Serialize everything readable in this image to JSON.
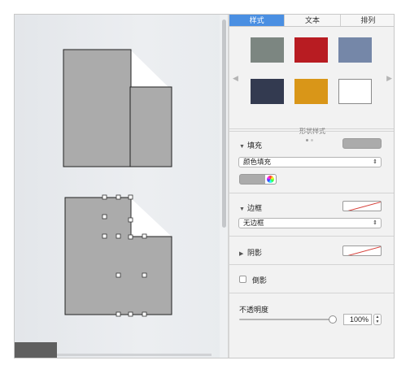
{
  "inspector": {
    "tabs": [
      {
        "label": "样式",
        "active": true
      },
      {
        "label": "文本",
        "active": false
      },
      {
        "label": "排列",
        "active": false
      }
    ],
    "styles": {
      "label": "形状样式",
      "swatches": [
        "#7c8681",
        "#b81c22",
        "#7587a8",
        "#333a50",
        "#d99618",
        "#ffffff"
      ],
      "prev_arrow": "◀",
      "next_arrow": "▶"
    },
    "fill": {
      "title": "填充",
      "select_value": "颜色填充",
      "color": "#ababab"
    },
    "border": {
      "title": "边框",
      "select_value": "无边框"
    },
    "shadow": {
      "title": "阴影"
    },
    "reflection": {
      "label": "倒影",
      "checked": false
    },
    "opacity": {
      "label": "不透明度",
      "value": "100%",
      "level": 1.0
    }
  },
  "icons": {
    "disclosure_open": "▼",
    "disclosure_closed": "▶",
    "select_chevron": "⇕",
    "stepper_up": "▲",
    "stepper_down": "▼"
  }
}
